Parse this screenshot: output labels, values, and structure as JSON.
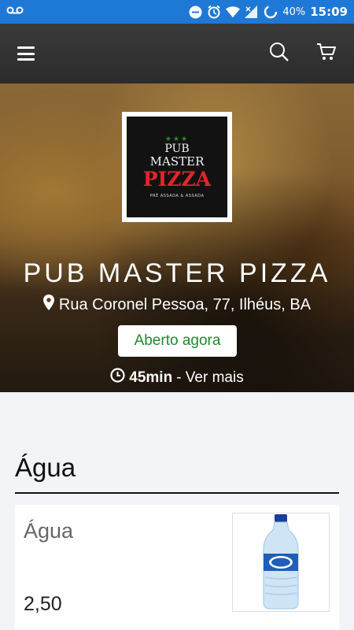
{
  "status_bar": {
    "battery": "40%",
    "time": "15:09"
  },
  "app_bar": {
    "menu_icon": "hamburger-menu-icon",
    "search_icon": "search-icon",
    "cart_icon": "cart-icon"
  },
  "restaurant": {
    "logo": {
      "line1": "PUB",
      "line2": "MASTER",
      "line3": "PIZZA",
      "line4": "PRÉ ASSADA & ASSADA"
    },
    "name": "PUB MASTER PIZZA",
    "address": "Rua Coronel Pessoa, 77, Ilhéus, BA",
    "status": "Aberto agora",
    "delivery_time": "45min",
    "see_more": " - Ver mais"
  },
  "menu": {
    "section_title": "Água",
    "items": [
      {
        "name": "Água",
        "price": "2,50",
        "image_icon": "water-bottle-image"
      }
    ]
  },
  "colors": {
    "status_bar": "#1e78d6",
    "app_bar": "#333333",
    "open_text": "#1d8a2f",
    "logo_red": "#e3262a"
  }
}
